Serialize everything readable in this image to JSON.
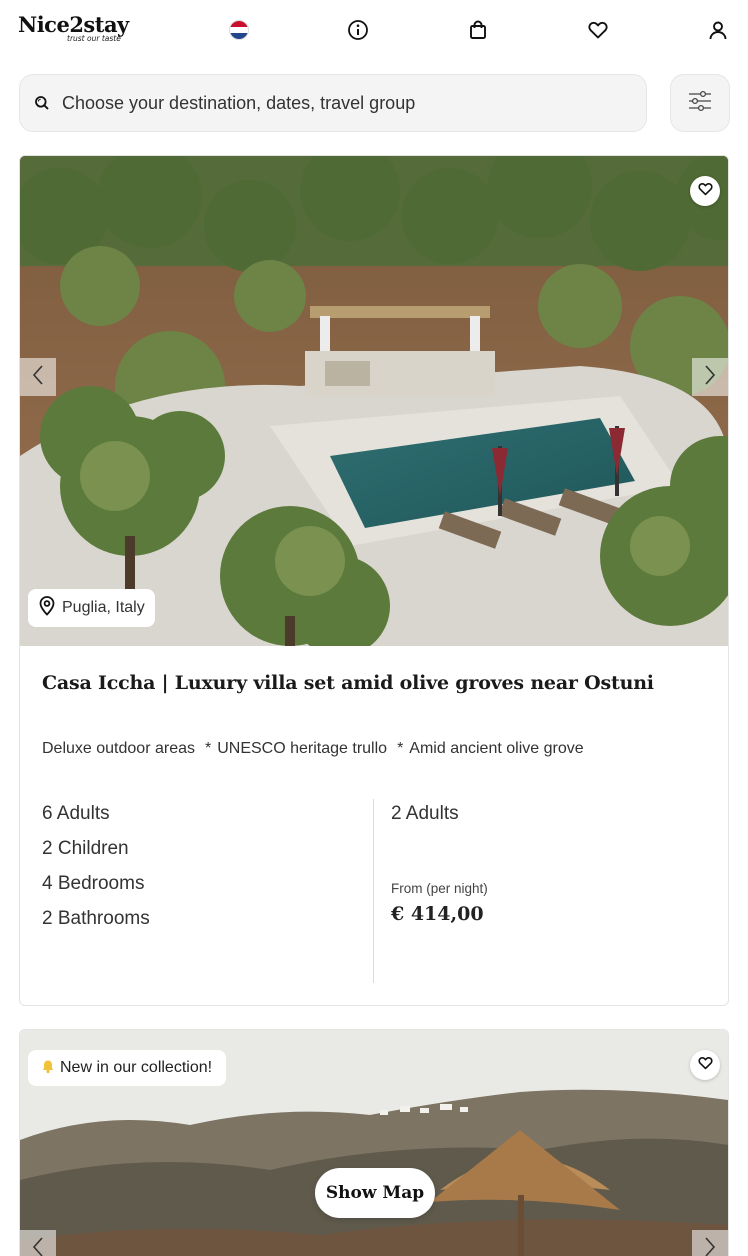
{
  "header": {
    "logo_text": "Nice2stay",
    "logo_tagline": "trust our taste",
    "icons": [
      "flag-nl-icon",
      "info-icon",
      "shopping-bag-icon",
      "heart-icon",
      "user-icon"
    ]
  },
  "search": {
    "placeholder": "Choose your destination, dates, travel group",
    "filter_icon": "sliders-icon"
  },
  "listings": [
    {
      "location": "Puglia, Italy",
      "title": "Casa Iccha | Luxury villa set amid olive groves near Ostuni",
      "features": [
        "Deluxe outdoor areas",
        "UNESCO heritage trullo",
        "Amid ancient olive grove"
      ],
      "feature_separator": "*",
      "capacity": [
        "6 Adults",
        "2 Children",
        "4 Bedrooms",
        "2 Bathrooms"
      ],
      "selected_guests": "2 Adults",
      "price_label": "From (per night)",
      "price": "€ 414,00"
    },
    {
      "badge": "New in our collection!",
      "badge_icon": "bell-icon"
    }
  ],
  "show_map_label": "Show Map",
  "colors": {
    "background": "#ffffff",
    "search_bg": "#f4f4f4",
    "flag_red": "#c8102e",
    "flag_blue": "#21468b",
    "text": "#1f1f1f"
  }
}
